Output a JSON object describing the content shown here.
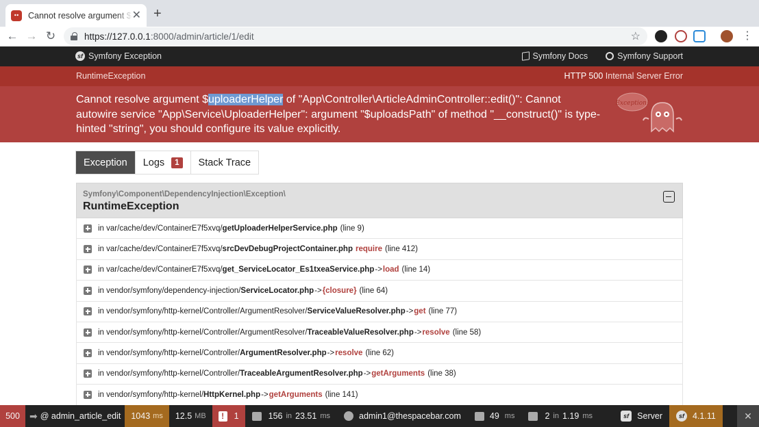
{
  "browser": {
    "tab_title": "Cannot resolve argument $uploaderHelper",
    "new_tab_symbol": "+",
    "close_symbol": "✕",
    "url_host": "https://127.0.0.1",
    "url_path": ":8000/admin/article/1/edit",
    "back_symbol": "←",
    "forward_symbol": "→",
    "reload_symbol": "↻",
    "star_symbol": "☆",
    "menu_symbol": "⋮"
  },
  "header": {
    "brand": "Symfony Exception",
    "docs_link": "Symfony Docs",
    "support_link": "Symfony Support"
  },
  "exception": {
    "class": "RuntimeException",
    "status_code": "HTTP 500",
    "status_text": "Internal Server Error",
    "message_before": "Cannot resolve argument $",
    "message_highlight": "uploaderHelper",
    "message_after": " of \"App\\Controller\\ArticleAdminController::edit()\": Cannot autowire service \"App\\Service\\UploaderHelper\": argument \"$uploadsPath\" of method \"__construct()\" is type-hinted \"string\", you should configure its value explicitly.",
    "ghost_bubble": "Exception!"
  },
  "tabs": {
    "exception": "Exception",
    "logs": "Logs",
    "logs_count": "1",
    "stack_trace": "Stack Trace"
  },
  "trace": {
    "namespace": "Symfony\\Component\\DependencyInjection\\Exception\\",
    "class": "RuntimeException",
    "rows": [
      {
        "prefix": "in var/cache/dev/ContainerE7f5xvq/",
        "file": "getUploaderHelperService.php",
        "arrow": "",
        "func": "",
        "line": "(line 9)"
      },
      {
        "prefix": "in var/cache/dev/ContainerE7f5xvq/",
        "file": "srcDevDebugProjectContainer.php",
        "arrow": "",
        "func": "require",
        "line": "(line 412)"
      },
      {
        "prefix": "in var/cache/dev/ContainerE7f5xvq/",
        "file": "get_ServiceLocator_Es1txeaService.php",
        "arrow": "->",
        "func": "load",
        "line": "(line 14)"
      },
      {
        "prefix": "in vendor/symfony/dependency-injection/",
        "file": "ServiceLocator.php",
        "arrow": "->",
        "func": "{closure}",
        "line": "(line 64)"
      },
      {
        "prefix": "in vendor/symfony/http-kernel/Controller/ArgumentResolver/",
        "file": "ServiceValueResolver.php",
        "arrow": "->",
        "func": "get",
        "line": "(line 77)"
      },
      {
        "prefix": "in vendor/symfony/http-kernel/Controller/ArgumentResolver/",
        "file": "TraceableValueResolver.php",
        "arrow": "->",
        "func": "resolve",
        "line": "(line 58)"
      },
      {
        "prefix": "in vendor/symfony/http-kernel/Controller/",
        "file": "ArgumentResolver.php",
        "arrow": "->",
        "func": "resolve",
        "line": "(line 62)"
      },
      {
        "prefix": "in vendor/symfony/http-kernel/Controller/",
        "file": "TraceableArgumentResolver.php",
        "arrow": "->",
        "func": "getArguments",
        "line": "(line 38)"
      },
      {
        "prefix": "in vendor/symfony/http-kernel/",
        "file": "HttpKernel.php",
        "arrow": "->",
        "func": "getArguments",
        "line": "(line 141)"
      }
    ]
  },
  "toolbar": {
    "status": "500",
    "route": "@ admin_article_edit",
    "time_value": "1043",
    "time_unit": "ms",
    "memory_value": "12.5",
    "memory_unit": "MB",
    "errors": "1",
    "cache_count": "156",
    "cache_in": "in",
    "cache_time": "23.51",
    "cache_unit": "ms",
    "user": "admin1@thespacebar.com",
    "form_time": "49",
    "form_unit": "ms",
    "db_queries": "2",
    "db_in": "in",
    "db_time": "1.19",
    "db_unit": "ms",
    "server": "Server",
    "version": "4.1.11",
    "close_symbol": "✕"
  },
  "colors": {
    "accent_red": "#b0413e",
    "dark_header": "#222222",
    "toolbar_orange": "#a46a1f"
  }
}
